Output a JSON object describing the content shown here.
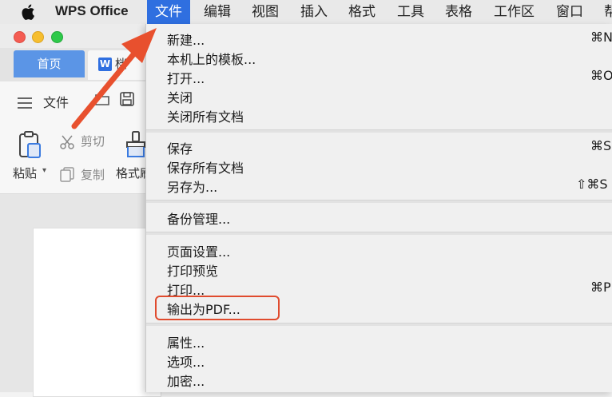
{
  "menubar": {
    "app_name": "WPS Office",
    "items": [
      "文件",
      "编辑",
      "视图",
      "插入",
      "格式",
      "工具",
      "表格",
      "工作区",
      "窗口",
      "帮"
    ]
  },
  "window": {
    "tabs": {
      "home": "首页",
      "doc": "档",
      "doc_icon": "W"
    },
    "toolbar": {
      "file_label": "文件",
      "paste_label": "粘贴",
      "cut_label": "剪切",
      "copy_label": "复制",
      "format_label": "格式刷"
    }
  },
  "file_menu": {
    "groups": [
      {
        "items": [
          {
            "label": "新建...",
            "shortcut": "⌘N"
          },
          {
            "label": "本机上的模板...",
            "shortcut": ""
          },
          {
            "label": "打开...",
            "shortcut": "⌘O"
          },
          {
            "label": "关闭",
            "shortcut": ""
          },
          {
            "label": "关闭所有文档",
            "shortcut": ""
          }
        ]
      },
      {
        "items": [
          {
            "label": "保存",
            "shortcut": "⌘S"
          },
          {
            "label": "保存所有文档",
            "shortcut": ""
          },
          {
            "label": "另存为...",
            "shortcut": "⇧⌘S"
          }
        ]
      },
      {
        "items": [
          {
            "label": "备份管理...",
            "shortcut": ""
          }
        ]
      },
      {
        "items": [
          {
            "label": "页面设置...",
            "shortcut": ""
          },
          {
            "label": "打印预览",
            "shortcut": ""
          },
          {
            "label": "打印...",
            "shortcut": "⌘P"
          },
          {
            "label": "输出为PDF...",
            "shortcut": ""
          }
        ]
      },
      {
        "items": [
          {
            "label": "属性...",
            "shortcut": ""
          },
          {
            "label": "选项...",
            "shortcut": ""
          },
          {
            "label": "加密...",
            "shortcut": ""
          }
        ]
      }
    ]
  },
  "colors": {
    "active_menu": "#2f6fe0",
    "annotation": "#e04b2e",
    "home_tab": "#5b95e6"
  }
}
